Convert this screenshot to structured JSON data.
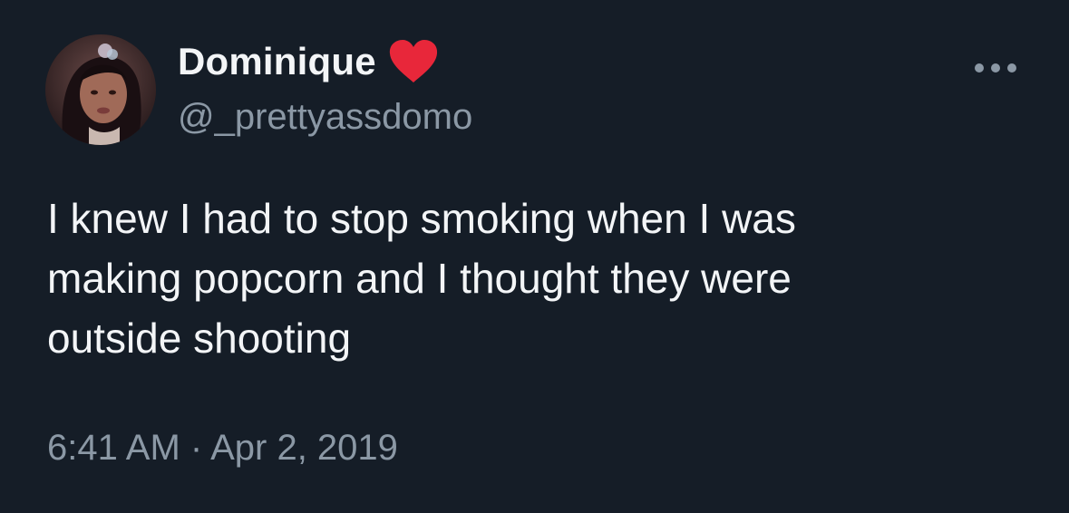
{
  "tweet": {
    "author": {
      "display_name": "Dominique",
      "handle": "@_prettyassdomo",
      "badge_icon": "red-heart-icon",
      "avatar": "profile-photo"
    },
    "more_icon": "more-dots-icon",
    "text": "I knew I had to stop smoking when I was\nmaking popcorn and I thought they were\noutside shooting",
    "timestamp": "6:41 AM · Apr 2, 2019"
  },
  "colors": {
    "background": "#151d27",
    "primary_text": "#f3f5f7",
    "secondary_text": "#8b98a5",
    "heart": "#e8273a"
  }
}
